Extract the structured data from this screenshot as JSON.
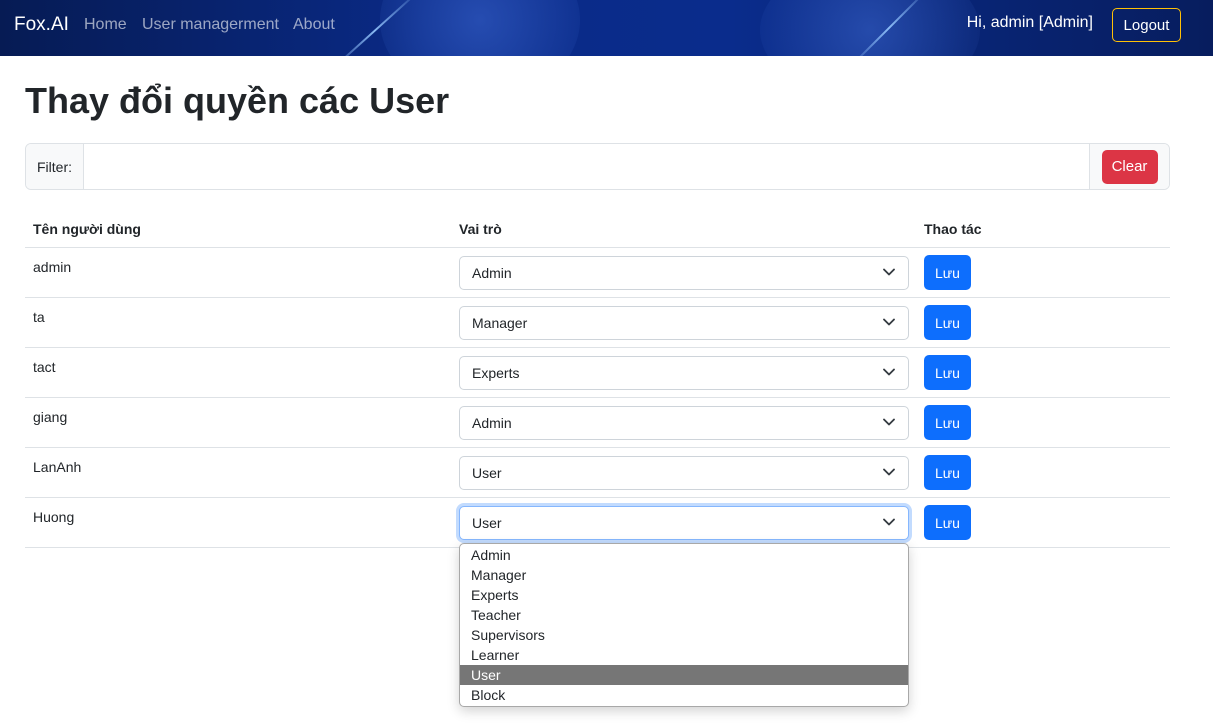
{
  "navbar": {
    "brand": "Fox.AI",
    "links": [
      "Home",
      "User managerment",
      "About"
    ],
    "greeting": "Hi, admin [Admin]",
    "logout_label": "Logout"
  },
  "page": {
    "title": "Thay đổi quyền các User"
  },
  "filter": {
    "label": "Filter:",
    "value": "",
    "clear_label": "Clear"
  },
  "table": {
    "headers": [
      "Tên người dùng",
      "Vai trò",
      "Thao tác"
    ],
    "save_label": "Lưu",
    "rows": [
      {
        "username": "admin",
        "role": "Admin"
      },
      {
        "username": "ta",
        "role": "Manager"
      },
      {
        "username": "tact",
        "role": "Experts"
      },
      {
        "username": "giang",
        "role": "Admin"
      },
      {
        "username": "LanAnh",
        "role": "User"
      },
      {
        "username": "Huong",
        "role": "User"
      }
    ]
  },
  "role_dropdown": {
    "options": [
      "Admin",
      "Manager",
      "Experts",
      "Teacher",
      "Supervisors",
      "Learner",
      "User",
      "Block"
    ],
    "highlighted": "User"
  },
  "colors": {
    "primary": "#0d6efd",
    "danger": "#dc3545",
    "warning": "#ffc107",
    "nav_bg": "#0a2a86"
  }
}
